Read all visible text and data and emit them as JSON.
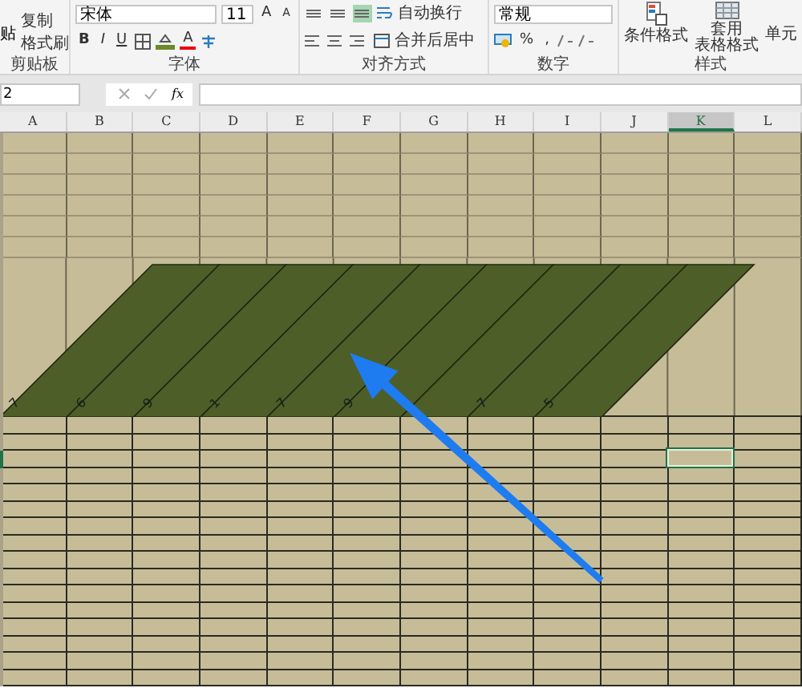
{
  "ribbon": {
    "clipboard": {
      "paste": "贴",
      "copy": "复制",
      "format_painter": "格式刷",
      "group_label": "剪贴板"
    },
    "font": {
      "font_name": "宋体",
      "font_size": "11",
      "grow_font": "A",
      "shrink_font": "A",
      "bold": "B",
      "italic": "I",
      "underline": "U",
      "font_color": "A",
      "group_label": "字体"
    },
    "alignment": {
      "vertical_align": [
        {
          "selected": false
        },
        {
          "selected": false
        },
        {
          "selected": true
        }
      ],
      "wrap_text": "自动换行",
      "merge_center": "合并后居中",
      "group_label": "对齐方式"
    },
    "number": {
      "format": "常规",
      "percent": "%",
      "comma": ",",
      "group_label": "数字"
    },
    "styles": {
      "conditional_formatting": "条件格式",
      "table_format_line1": "套用",
      "table_format_line2": "表格格式",
      "cell_styles": "单元",
      "group_label": "样式"
    }
  },
  "formula_bar": {
    "name_box": "2",
    "function_label": "fx"
  },
  "columns": [
    {
      "label": "A",
      "selected": false,
      "in_band": true,
      "band_label": "7"
    },
    {
      "label": "B",
      "selected": false,
      "in_band": true,
      "band_label": "6"
    },
    {
      "label": "C",
      "selected": false,
      "in_band": true,
      "band_label": "9"
    },
    {
      "label": "D",
      "selected": false,
      "in_band": true,
      "band_label": "1"
    },
    {
      "label": "E",
      "selected": false,
      "in_band": true,
      "band_label": "7"
    },
    {
      "label": "F",
      "selected": false,
      "in_band": true,
      "band_label": "9"
    },
    {
      "label": "G",
      "selected": false,
      "in_band": true
    },
    {
      "label": "H",
      "selected": false,
      "in_band": true,
      "band_label": "7"
    },
    {
      "label": "I",
      "selected": false,
      "in_band": true,
      "band_label": "5"
    },
    {
      "label": "J",
      "selected": false,
      "in_band": false
    },
    {
      "label": "K",
      "selected": true,
      "in_band": false
    },
    {
      "label": "L",
      "selected": false,
      "in_band": false
    }
  ],
  "rows": [
    {
      "kind": "short",
      "selected": false
    },
    {
      "kind": "short",
      "selected": false
    },
    {
      "kind": "short",
      "selected": false
    },
    {
      "kind": "short",
      "selected": false
    },
    {
      "kind": "short",
      "selected": false
    },
    {
      "kind": "short",
      "selected": false
    },
    {
      "kind": "tall",
      "selected": false
    },
    {
      "kind": "thin",
      "selected": false
    },
    {
      "kind": "thin",
      "selected": false
    },
    {
      "kind": "thin",
      "selected": true
    },
    {
      "kind": "thin",
      "selected": false
    },
    {
      "kind": "thin",
      "selected": false
    },
    {
      "kind": "thin",
      "selected": false
    },
    {
      "kind": "thin",
      "selected": false
    },
    {
      "kind": "thin",
      "selected": false
    },
    {
      "kind": "thin",
      "selected": false
    },
    {
      "kind": "thin",
      "selected": false
    },
    {
      "kind": "thin",
      "selected": false
    },
    {
      "kind": "thin",
      "selected": false
    },
    {
      "kind": "thin",
      "selected": false
    },
    {
      "kind": "thin",
      "selected": false
    },
    {
      "kind": "thin",
      "selected": false
    },
    {
      "kind": "thin",
      "selected": false
    }
  ]
}
